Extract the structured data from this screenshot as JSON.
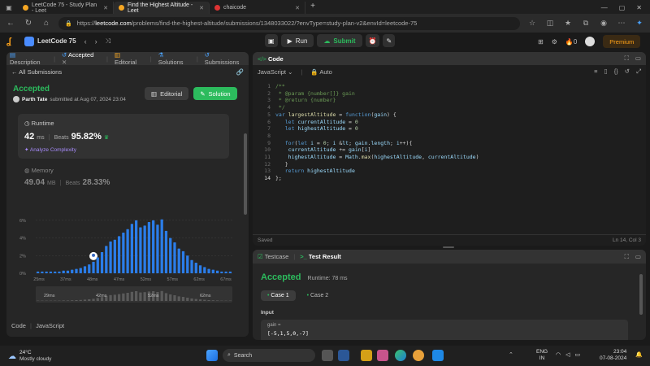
{
  "browser": {
    "tabs": [
      {
        "label": "LeetCode 75 - Study Plan - Leet",
        "active": false
      },
      {
        "label": "Find the Highest Altitude - Leet",
        "active": true
      },
      {
        "label": "chaicode",
        "active": false
      }
    ],
    "url_prefix": "https://",
    "url_domain": "leetcode.com",
    "url_rest": "/problems/find-the-highest-altitude/submissions/1348033022/?envType=study-plan-v2&envId=leetcode-75"
  },
  "header": {
    "title": "LeetCode 75",
    "run_label": "Run",
    "submit_label": "Submit",
    "streak": "0",
    "premium_label": "Premium"
  },
  "left": {
    "tabs": [
      "Description",
      "Accepted",
      "Editorial",
      "Solutions",
      "Submissions"
    ],
    "all_submissions": "All Submissions",
    "status": "Accepted",
    "author": "Parth Tate",
    "submitted_text": "submitted at Aug 07, 2024 23:04",
    "editorial_btn": "Editorial",
    "solution_btn": "Solution",
    "runtime_label": "Runtime",
    "runtime_value": "42",
    "runtime_unit": "ms",
    "beats_label": "Beats",
    "runtime_beats": "95.82%",
    "analyze_label": "Analyze Complexity",
    "memory_label": "Memory",
    "memory_value": "49.04",
    "memory_unit": "MB",
    "memory_beats": "28.33%",
    "bottom_tabs": [
      "Code",
      "JavaScript"
    ]
  },
  "chart_data": {
    "type": "bar",
    "y_ticks": [
      "6%",
      "4%",
      "2%",
      "0%"
    ],
    "x_ticks": [
      "25ms",
      "37ms",
      "48ms",
      "47ms",
      "52ms",
      "57ms",
      "62ms",
      "67ms"
    ],
    "values": [
      0.2,
      0.2,
      0.2,
      0.2,
      0.2,
      0.2,
      0.3,
      0.3,
      0.4,
      0.5,
      0.6,
      0.8,
      1.0,
      1.3,
      1.8,
      2.4,
      3.1,
      3.6,
      3.8,
      4.2,
      4.6,
      5.0,
      5.6,
      6.0,
      5.2,
      5.4,
      5.8,
      6.0,
      5.5,
      6.1,
      4.8,
      4.0,
      3.5,
      2.8,
      2.5,
      2.0,
      1.5,
      1.2,
      0.9,
      0.7,
      0.5,
      0.4,
      0.3,
      0.2,
      0.2,
      0.2
    ],
    "highlight_index": 13,
    "ylim": [
      0,
      7
    ],
    "mini_labels": [
      "29ms",
      "42ms",
      "52ms",
      "62ms"
    ]
  },
  "code": {
    "header": "Code",
    "language": "JavaScript",
    "mode": "Auto",
    "saved": "Saved",
    "cursor": "Ln 14, Col 3",
    "lines": [
      "/**",
      " * @param {number[]} gain",
      " * @return {number}",
      " */",
      "var largestAltitude = function(gain) {",
      "   let currentAltitude = 0",
      "   let highestAltitude = 0",
      "",
      "   for(let i = 0; i < gain.length; i++){",
      "    currentAltitude += gain[i]",
      "    highestAltitude = Math.max(highestAltitude, currentAltitude)",
      "   }",
      "   return highestAltitude",
      "};"
    ]
  },
  "testresult": {
    "testcase_tab": "Testcase",
    "result_tab": "Test Result",
    "status": "Accepted",
    "runtime": "Runtime: 78 ms",
    "cases": [
      "Case 1",
      "Case 2"
    ],
    "input_label": "Input",
    "var_label": "gain =",
    "var_value": "[-5,1,5,0,-7]"
  },
  "taskbar": {
    "temp": "24°C",
    "weather": "Mostly cloudy",
    "search": "Search",
    "lang": "ENG",
    "region": "IN",
    "time": "23:04",
    "date": "07-08-2024"
  }
}
